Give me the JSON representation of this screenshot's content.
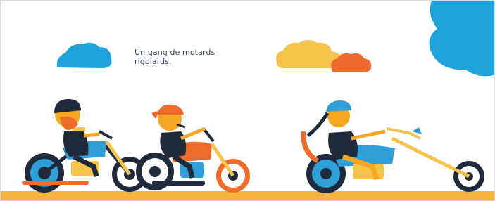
{
  "caption": {
    "line1": "Un gang de motards",
    "line2": "rigolards."
  },
  "colors": {
    "sky_blue": "#1ea3dc",
    "cloud_yellow": "#f7c34a",
    "cloud_orange": "#ec6a2c",
    "ground": "#f6b43c",
    "dark": "#1f2a3d",
    "bike_orange": "#ef6b2a",
    "bike_blue": "#2f9fd8",
    "skin": "#f5a623"
  },
  "illustration": {
    "riders": [
      "bearded-biker-with-helmet",
      "biker-with-bandana",
      "female-biker-with-helmet"
    ],
    "icons": [
      "cloud-icon",
      "motorcycle-icon"
    ]
  }
}
